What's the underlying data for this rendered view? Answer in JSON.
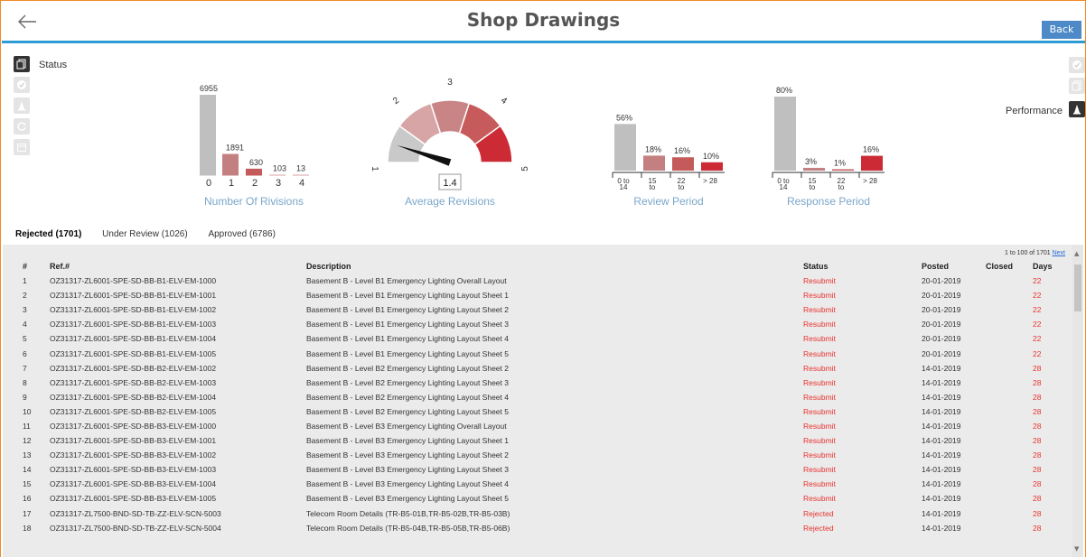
{
  "header": {
    "title": "Shop Drawings",
    "back_label": "Back"
  },
  "status_label": "Status",
  "performance_label": "Performance",
  "charts": {
    "revisions": {
      "caption": "Number Of Rivisions",
      "categories": [
        "0",
        "1",
        "2",
        "3",
        "4"
      ],
      "values": [
        6955,
        1891,
        630,
        103,
        13
      ],
      "labels": [
        "6955",
        "1891",
        "630",
        "103",
        "13"
      ]
    },
    "average": {
      "caption": "Average Revisions",
      "value": "1.4",
      "numeric": 1.4,
      "ticks": [
        "1",
        "2",
        "3",
        "4",
        "5"
      ]
    },
    "review": {
      "caption": "Review Period",
      "categories": [
        [
          "0 to",
          "14"
        ],
        [
          "15",
          "to"
        ],
        [
          "22",
          "to"
        ],
        [
          "> 28",
          ""
        ]
      ],
      "values": [
        56,
        18,
        16,
        10
      ],
      "labels": [
        "56%",
        "18%",
        "16%",
        "10%"
      ]
    },
    "response": {
      "caption": "Response Period",
      "categories": [
        [
          "0 to",
          "14"
        ],
        [
          "15",
          "to"
        ],
        [
          "22",
          "to"
        ],
        [
          "> 28",
          ""
        ]
      ],
      "values": [
        80,
        3,
        1,
        16
      ],
      "labels": [
        "80%",
        "3%",
        "1%",
        "16%"
      ]
    },
    "colors": [
      "#bfbfbf",
      "#c48080",
      "#c45a5a",
      "#cc2a35",
      "#d9a0a0"
    ]
  },
  "tabs": [
    "Rejected (1701)",
    "Under Review (1026)",
    "Approved (6786)"
  ],
  "pager": {
    "text": "1 to 100 of 1701",
    "next": "Next"
  },
  "table": {
    "headers": {
      "num": "#",
      "ref": "Ref.#",
      "desc": "Description",
      "status": "Status",
      "posted": "Posted",
      "closed": "Closed",
      "days": "Days"
    },
    "rows": [
      [
        "1",
        "OZ31317-ZL6001-SPE-SD-BB-B1-ELV-EM-1000",
        "Basement B - Level B1 Emergency Lighting Overall Layout",
        "Resubmit",
        "20-01-2019",
        "",
        "22"
      ],
      [
        "2",
        "OZ31317-ZL6001-SPE-SD-BB-B1-ELV-EM-1001",
        "Basement B - Level B1 Emergency Lighting Layout Sheet 1",
        "Resubmit",
        "20-01-2019",
        "",
        "22"
      ],
      [
        "3",
        "OZ31317-ZL6001-SPE-SD-BB-B1-ELV-EM-1002",
        "Basement B - Level B1 Emergency Lighting Layout Sheet 2",
        "Resubmit",
        "20-01-2019",
        "",
        "22"
      ],
      [
        "4",
        "OZ31317-ZL6001-SPE-SD-BB-B1-ELV-EM-1003",
        "Basement B - Level B1 Emergency Lighting Layout Sheet 3",
        "Resubmit",
        "20-01-2019",
        "",
        "22"
      ],
      [
        "5",
        "OZ31317-ZL6001-SPE-SD-BB-B1-ELV-EM-1004",
        "Basement B - Level B1 Emergency Lighting Layout Sheet 4",
        "Resubmit",
        "20-01-2019",
        "",
        "22"
      ],
      [
        "6",
        "OZ31317-ZL6001-SPE-SD-BB-B1-ELV-EM-1005",
        "Basement B - Level B1 Emergency Lighting Layout Sheet 5",
        "Resubmit",
        "20-01-2019",
        "",
        "22"
      ],
      [
        "7",
        "OZ31317-ZL6001-SPE-SD-BB-B2-ELV-EM-1002",
        "Basement B - Level B2 Emergency Lighting Layout Sheet 2",
        "Resubmit",
        "14-01-2019",
        "",
        "28"
      ],
      [
        "8",
        "OZ31317-ZL6001-SPE-SD-BB-B2-ELV-EM-1003",
        "Basement B - Level B2 Emergency Lighting Layout Sheet 3",
        "Resubmit",
        "14-01-2019",
        "",
        "28"
      ],
      [
        "9",
        "OZ31317-ZL6001-SPE-SD-BB-B2-ELV-EM-1004",
        "Basement B - Level B2 Emergency Lighting Layout Sheet 4",
        "Resubmit",
        "14-01-2019",
        "",
        "28"
      ],
      [
        "10",
        "OZ31317-ZL6001-SPE-SD-BB-B2-ELV-EM-1005",
        "Basement B - Level B2 Emergency Lighting Layout Sheet 5",
        "Resubmit",
        "14-01-2019",
        "",
        "28"
      ],
      [
        "11",
        "OZ31317-ZL6001-SPE-SD-BB-B3-ELV-EM-1000",
        "Basement B - Level B3 Emergency Lighting Overall Layout",
        "Resubmit",
        "14-01-2019",
        "",
        "28"
      ],
      [
        "12",
        "OZ31317-ZL6001-SPE-SD-BB-B3-ELV-EM-1001",
        "Basement B - Level B3 Emergency Lighting Layout Sheet 1",
        "Resubmit",
        "14-01-2019",
        "",
        "28"
      ],
      [
        "13",
        "OZ31317-ZL6001-SPE-SD-BB-B3-ELV-EM-1002",
        "Basement B - Level B3 Emergency Lighting Layout Sheet 2",
        "Resubmit",
        "14-01-2019",
        "",
        "28"
      ],
      [
        "14",
        "OZ31317-ZL6001-SPE-SD-BB-B3-ELV-EM-1003",
        "Basement B - Level B3 Emergency Lighting Layout Sheet 3",
        "Resubmit",
        "14-01-2019",
        "",
        "28"
      ],
      [
        "15",
        "OZ31317-ZL6001-SPE-SD-BB-B3-ELV-EM-1004",
        "Basement B - Level B3 Emergency Lighting Layout Sheet 4",
        "Resubmit",
        "14-01-2019",
        "",
        "28"
      ],
      [
        "16",
        "OZ31317-ZL6001-SPE-SD-BB-B3-ELV-EM-1005",
        "Basement B - Level B3 Emergency Lighting Layout Sheet 5",
        "Resubmit",
        "14-01-2019",
        "",
        "28"
      ],
      [
        "17",
        "OZ31317-ZL7500-BND-SD-TB-ZZ-ELV-SCN-5003",
        "Telecom Room Details (TR-B5-01B,TR-B5-02B,TR-B5-03B)",
        "Rejected",
        "14-01-2019",
        "",
        "28"
      ],
      [
        "18",
        "OZ31317-ZL7500-BND-SD-TB-ZZ-ELV-SCN-5004",
        "Telecom Room Details (TR-B5-04B,TR-B5-05B,TR-B5-06B)",
        "Rejected",
        "14-01-2019",
        "",
        "28"
      ]
    ]
  }
}
